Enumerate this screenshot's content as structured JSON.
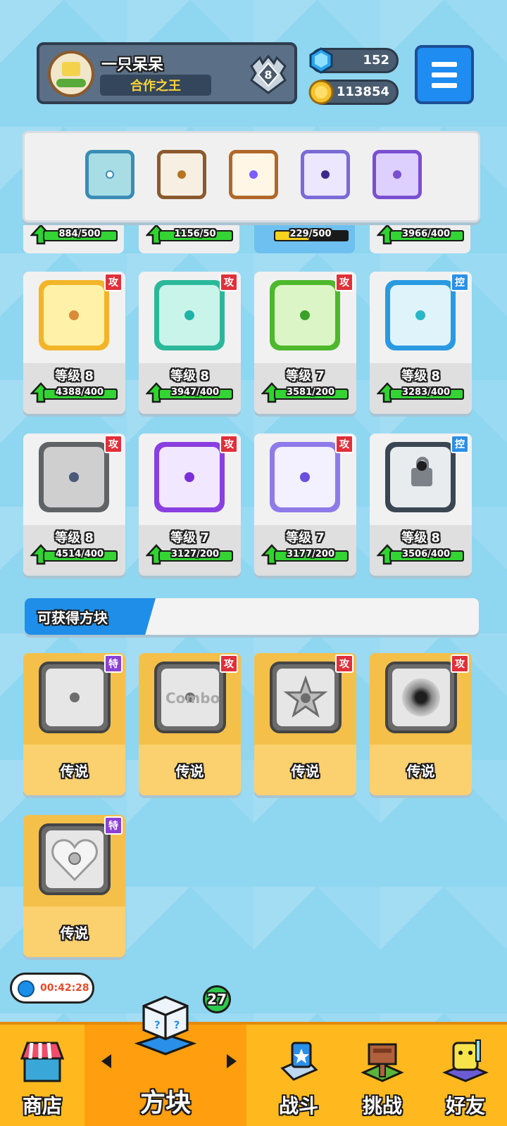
{
  "player": {
    "name": "一只呆呆",
    "title": "合作之王",
    "rank": "8"
  },
  "currency": {
    "gems": "152",
    "coins": "113854"
  },
  "icons": {
    "menu": "hamburger-menu-icon",
    "gem": "gem-icon",
    "coin": "coin-icon",
    "rank": "rank-shield-icon",
    "timer": "stopwatch-icon"
  },
  "partial_row": [
    {
      "progress_text": "884/500",
      "progress": 1.0
    },
    {
      "progress_text": "1156/50",
      "progress": 1.0
    },
    {
      "progress_text": "229/500",
      "progress": 0.46
    },
    {
      "progress_text": "3966/400",
      "progress": 1.0
    }
  ],
  "owned_dice": [
    {
      "tag": "攻",
      "level": "等级 8",
      "progress_text": "4388/400",
      "progress": 1.0
    },
    {
      "tag": "攻",
      "level": "等级 8",
      "progress_text": "3947/400",
      "progress": 1.0
    },
    {
      "tag": "攻",
      "level": "等级 7",
      "progress_text": "3581/200",
      "progress": 1.0
    },
    {
      "tag": "控",
      "level": "等级 8",
      "progress_text": "3283/400",
      "progress": 1.0
    },
    {
      "tag": "攻",
      "level": "等级 8",
      "progress_text": "4514/400",
      "progress": 1.0
    },
    {
      "tag": "攻",
      "level": "等级 7",
      "progress_text": "3127/200",
      "progress": 1.0
    },
    {
      "tag": "攻",
      "level": "等级 7",
      "progress_text": "3177/200",
      "progress": 1.0
    },
    {
      "tag": "控",
      "level": "等级 8",
      "progress_text": "3506/400",
      "progress": 1.0
    }
  ],
  "available_section": {
    "title": "可获得方块"
  },
  "available_dice": [
    {
      "tag": "特",
      "rarity": "传说"
    },
    {
      "tag": "攻",
      "rarity": "传说"
    },
    {
      "tag": "攻",
      "rarity": "传说"
    },
    {
      "tag": "攻",
      "rarity": "传说"
    },
    {
      "tag": "特",
      "rarity": "传说"
    }
  ],
  "combo_text": "Combo",
  "timer": "00:42:28",
  "nav": {
    "badge": "27",
    "items": [
      {
        "label": "商店"
      },
      {
        "label": "方块"
      },
      {
        "label": "战斗"
      },
      {
        "label": "挑战"
      },
      {
        "label": "好友"
      }
    ]
  }
}
